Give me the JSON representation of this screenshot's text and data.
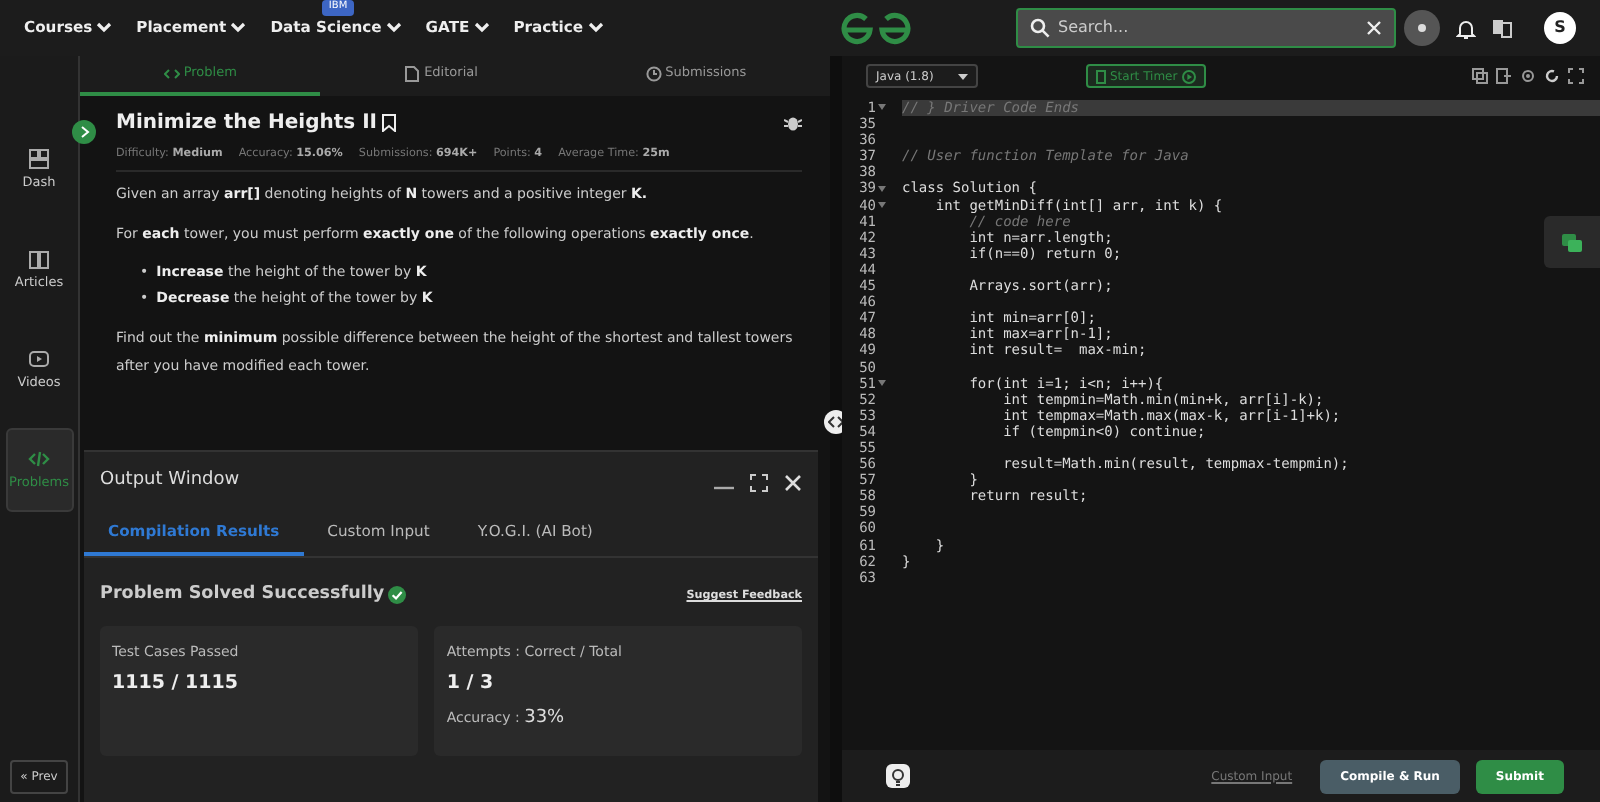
{
  "nav": {
    "items": [
      {
        "label": "Courses"
      },
      {
        "label": "Placement"
      },
      {
        "label": "Data Science",
        "badge": "IBM"
      },
      {
        "label": "GATE"
      },
      {
        "label": "Practice"
      }
    ],
    "search": {
      "placeholder": "Search..."
    },
    "avatar": "S"
  },
  "sidebar": {
    "items": [
      {
        "label": "Dash",
        "selected": false
      },
      {
        "label": "Articles",
        "selected": false
      },
      {
        "label": "Videos",
        "selected": false
      },
      {
        "label": "Problems",
        "selected": true
      }
    ],
    "prev": "« Prev"
  },
  "problem_tabs": [
    {
      "label": "Problem",
      "selected": true
    },
    {
      "label": "Editorial",
      "selected": false
    },
    {
      "label": "Submissions",
      "selected": false
    }
  ],
  "problem": {
    "title": "Minimize the Heights II",
    "meta": [
      {
        "label": "Difficulty:",
        "value": "Medium"
      },
      {
        "label": "Accuracy:",
        "value": "15.06%"
      },
      {
        "label": "Submissions:",
        "value": "694K+"
      },
      {
        "label": "Points:",
        "value": "4"
      },
      {
        "label": "Average Time:",
        "value": "25m"
      }
    ],
    "paragraphs_before": [
      "Given an array **arr[]** denoting heights of **N** towers and a positive integer **K.**",
      "For **each** tower, you must perform **exactly one** of the following operations **exactly once**."
    ],
    "bullets": [
      {
        "marker": "•",
        "text": "**Increase** the height of the tower by **K**"
      },
      {
        "marker": "•",
        "text": "**Decrease** the height of the tower by **K**"
      }
    ],
    "paragraphs_after": [
      "Find out the **minimum** possible difference between the height of the shortest and tallest towers after you have modified each tower."
    ]
  },
  "output_window": {
    "title": "Output Window",
    "tabs": [
      {
        "label": "Compilation Results",
        "selected": true
      },
      {
        "label": "Custom Input",
        "selected": false
      },
      {
        "label": "Y.O.G.I. (AI Bot)",
        "selected": false
      }
    ],
    "status": "Problem Solved Successfully",
    "feedback": "Suggest Feedback",
    "cards": [
      {
        "label": "Test Cases Passed",
        "value": "1115 / 1115"
      },
      {
        "label": "Attempts : Correct / Total",
        "value": "1 / 3",
        "extra_label": "Accuracy :",
        "extra_value": "33%"
      }
    ]
  },
  "editor": {
    "language": "Java (1.8)",
    "timer": "Start Timer",
    "lines": [
      {
        "no": "1",
        "text": "// } Driver Code Ends",
        "kind": "comment",
        "fold": true,
        "highlight": true
      },
      {
        "no": "35",
        "kind": "code",
        "fold": false,
        "highlight": false
      },
      {
        "no": "36",
        "kind": "code",
        "fold": false,
        "highlight": false
      },
      {
        "no": "37",
        "text": "// User function Template for Java",
        "kind": "comment",
        "fold": false,
        "highlight": false
      },
      {
        "no": "38",
        "kind": "code",
        "fold": false,
        "highlight": false
      },
      {
        "no": "39",
        "text": "class Solution {",
        "kind": "code",
        "fold": true,
        "highlight": false
      },
      {
        "no": "40",
        "text": "    int getMinDiff(int[] arr, int k) {",
        "kind": "code",
        "fold": true,
        "highlight": false
      },
      {
        "no": "41",
        "text": "        // code here",
        "kind": "comment",
        "fold": false,
        "highlight": false
      },
      {
        "no": "42",
        "text": "        int n=arr.length;",
        "kind": "code",
        "fold": false,
        "highlight": false
      },
      {
        "no": "43",
        "text": "        if(n==0) return 0;",
        "kind": "code",
        "fold": false,
        "highlight": false
      },
      {
        "no": "44",
        "kind": "code",
        "fold": false,
        "highlight": false
      },
      {
        "no": "45",
        "text": "        Arrays.sort(arr);",
        "kind": "code",
        "fold": false,
        "highlight": false
      },
      {
        "no": "46",
        "kind": "code",
        "fold": false,
        "highlight": false
      },
      {
        "no": "47",
        "text": "        int min=arr[0];",
        "kind": "code",
        "fold": false,
        "highlight": false
      },
      {
        "no": "48",
        "text": "        int max=arr[n-1];",
        "kind": "code",
        "fold": false,
        "highlight": false
      },
      {
        "no": "49",
        "text": "        int result=  max-min;",
        "kind": "code",
        "fold": false,
        "highlight": false
      },
      {
        "no": "50",
        "kind": "code",
        "fold": false,
        "highlight": false
      },
      {
        "no": "51",
        "text": "        for(int i=1; i<n; i++){",
        "kind": "code",
        "fold": true,
        "highlight": false
      },
      {
        "no": "52",
        "text": "            int tempmin=Math.min(min+k, arr[i]-k);",
        "kind": "code",
        "fold": false,
        "highlight": false
      },
      {
        "no": "53",
        "text": "            int tempmax=Math.max(max-k, arr[i-1]+k);",
        "kind": "code",
        "fold": false,
        "highlight": false
      },
      {
        "no": "54",
        "text": "            if (tempmin<0) continue;",
        "kind": "code",
        "fold": false,
        "highlight": false
      },
      {
        "no": "55",
        "kind": "code",
        "fold": false,
        "highlight": false
      },
      {
        "no": "56",
        "text": "            result=Math.min(result, tempmax-tempmin);",
        "kind": "code",
        "fold": false,
        "highlight": false
      },
      {
        "no": "57",
        "text": "        }",
        "kind": "code",
        "fold": false,
        "highlight": false
      },
      {
        "no": "58",
        "text": "        return result;",
        "kind": "code",
        "fold": false,
        "highlight": false
      },
      {
        "no": "59",
        "kind": "code",
        "fold": false,
        "highlight": false
      },
      {
        "no": "60",
        "kind": "code",
        "fold": false,
        "highlight": false
      },
      {
        "no": "61",
        "text": "    }",
        "kind": "code",
        "fold": false,
        "highlight": false
      },
      {
        "no": "62",
        "text": "}",
        "kind": "code",
        "fold": false,
        "highlight": false
      },
      {
        "no": "63",
        "kind": "code",
        "fold": false,
        "highlight": false
      }
    ],
    "custom_input": "Custom Input",
    "compile": "Compile & Run",
    "submit": "Submit"
  }
}
